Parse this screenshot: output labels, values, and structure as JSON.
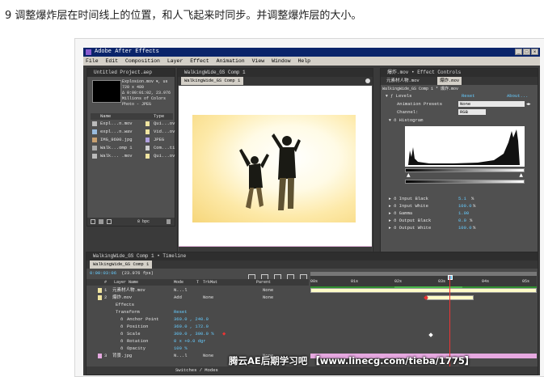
{
  "caption": "9 调整爆炸层在时间线上的位置，和人飞起来时同步。并调整爆炸层的大小。",
  "watermark": "腾云AE后期学习吧 【www.linecg.com/tieba/1775】",
  "app": {
    "title": "Adobe After Effects",
    "menu": [
      "File",
      "Edit",
      "Composition",
      "Layer",
      "Effect",
      "Animation",
      "View",
      "Window",
      "Help"
    ]
  },
  "project": {
    "title": "Untitled Project.aep",
    "info": [
      "Explosion.mov ▾, us",
      "720 x 480",
      "Δ 0:00:01:02, 23.976",
      "Millions of Colors",
      "Photo - JPEG"
    ],
    "columns": {
      "name": "Name",
      "type": "Type"
    },
    "items": [
      {
        "name": "Expl...n.mov",
        "type": "Qui...ov"
      },
      {
        "name": "expl...n.wav",
        "type": "Vid...ov"
      },
      {
        "name": "IMG_9600.jpg",
        "type": "JPEG"
      },
      {
        "name": "Walk...omp 1",
        "type": "Com...ti"
      },
      {
        "name": "Walk... .mov",
        "type": "Qui...ov"
      }
    ],
    "bpc": "8 bpc"
  },
  "comp_viewer": {
    "title": "WalkingWide_GS Comp 1",
    "tab": "WalkingWide_GS Comp 1"
  },
  "effect_controls": {
    "title": "爆炸.mov • Effect Controls",
    "tabs": [
      "元素材人物.mov",
      "爆炸.mov"
    ],
    "subtitle": "WalkingWide_GS Comp 1 * 爆炸.mov",
    "levels": {
      "label": "Levels",
      "reset": "Reset",
      "about": "About..."
    },
    "params": [
      {
        "label": "Animation Presets",
        "value": "None"
      },
      {
        "label": "Channel:",
        "value": "RGB"
      },
      {
        "label": "Histogram",
        "value": ""
      }
    ],
    "inputs": [
      {
        "label": "Input Black",
        "value": "5.1",
        "unit": "%"
      },
      {
        "label": "Input White",
        "value": "100.0",
        "unit": "%"
      },
      {
        "label": "Gamma",
        "value": "1.00",
        "unit": ""
      },
      {
        "label": "Output Black",
        "value": "0.0",
        "unit": "%"
      },
      {
        "label": "Output White",
        "value": "100.0",
        "unit": "%"
      }
    ]
  },
  "timeline": {
    "title": "WalkingWide_GS Comp 1 • Timeline",
    "tab": "WalkingWide_GS Comp 1",
    "timecode": "0:00:03:06",
    "fps": "(23.976 fps)",
    "columns": {
      "num": "#",
      "layer_name": "Layer Name",
      "mode": "Mode",
      "t": "T",
      "trkmat": "TrkMat",
      "parent": "Parent"
    },
    "ruler": [
      "00s",
      "01s",
      "02s",
      "03s",
      "04s",
      "05s"
    ],
    "layers": [
      {
        "num": "1",
        "name": "元素材人物.mov",
        "mode": "N...l",
        "trkmat": "",
        "parent": "None"
      },
      {
        "num": "2",
        "name": "爆炸.mov",
        "mode": "Add",
        "trkmat": "None",
        "parent": "None"
      }
    ],
    "effects_label": "Effects",
    "transform": {
      "label": "Transform",
      "reset": "Reset"
    },
    "props": [
      {
        "label": "Anchor Point",
        "value": "360.0 , 240.0"
      },
      {
        "label": "Position",
        "value": "360.0 , 172.0"
      },
      {
        "label": "Scale",
        "value": "300.0 , 300.0 %"
      },
      {
        "label": "Rotation",
        "value": "0 x +0.0 dgr"
      },
      {
        "label": "Opacity",
        "value": "100 %"
      }
    ],
    "layer3": {
      "num": "3",
      "name": "背景.jpg",
      "mode": "N...l",
      "trkmat": "None",
      "parent": "None"
    },
    "switches_label": "Switches / Modes"
  }
}
